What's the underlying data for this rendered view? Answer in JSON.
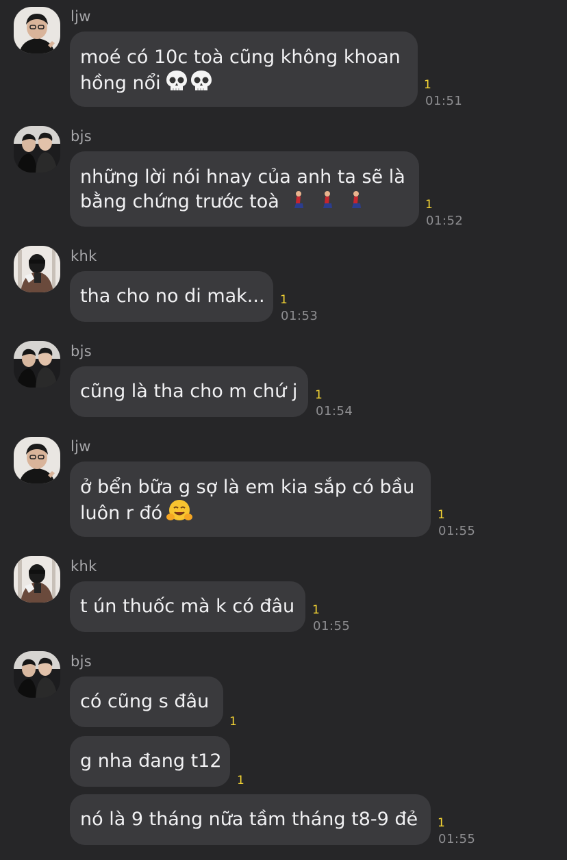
{
  "messages": [
    {
      "sender": "ljw",
      "lines": [
        "moé có 10c toà cũng không khoan",
        "hồng nổi"
      ],
      "emoji": "skull-x2",
      "unread": "1",
      "time": "01:51"
    },
    {
      "sender": "bjs",
      "lines": [
        "những lời nói hnay của anh ta sẽ là",
        "bằng chứng trước toà"
      ],
      "emoji": "kneeling-person-x3",
      "unread": "1",
      "time": "01:52"
    },
    {
      "sender": "khk",
      "lines": [
        "tha cho no di mak..."
      ],
      "unread": "1",
      "time": "01:53"
    },
    {
      "sender": "bjs",
      "lines": [
        "cũng là tha cho m chứ j"
      ],
      "unread": "1",
      "time": "01:54"
    },
    {
      "sender": "ljw",
      "lines": [
        "ở bển bữa g sợ là em kia sắp có bầu",
        "luôn r đó"
      ],
      "emoji": "hugging-face",
      "unread": "1",
      "time": "01:55"
    },
    {
      "sender": "khk",
      "lines": [
        "t ún thuốc mà k có đâu"
      ],
      "unread": "1",
      "time": "01:55"
    },
    {
      "sender": "bjs",
      "lines": [
        "có cũng s đâu"
      ],
      "unread": "1",
      "time": ""
    },
    {
      "sender": "bjs",
      "lines": [
        "g nha đang t12"
      ],
      "unread": "1",
      "time": ""
    },
    {
      "sender": "bjs",
      "lines": [
        "nó là 9 tháng nữa tầm tháng t8-9 đẻ"
      ],
      "unread": "1",
      "time": "01:55"
    }
  ],
  "colors": {
    "background": "#262628",
    "bubble": "#3a3a3d",
    "text": "#f1f1f3",
    "unread": "#f7d634",
    "time": "#8d8d90",
    "sender": "#a8a8ab"
  }
}
